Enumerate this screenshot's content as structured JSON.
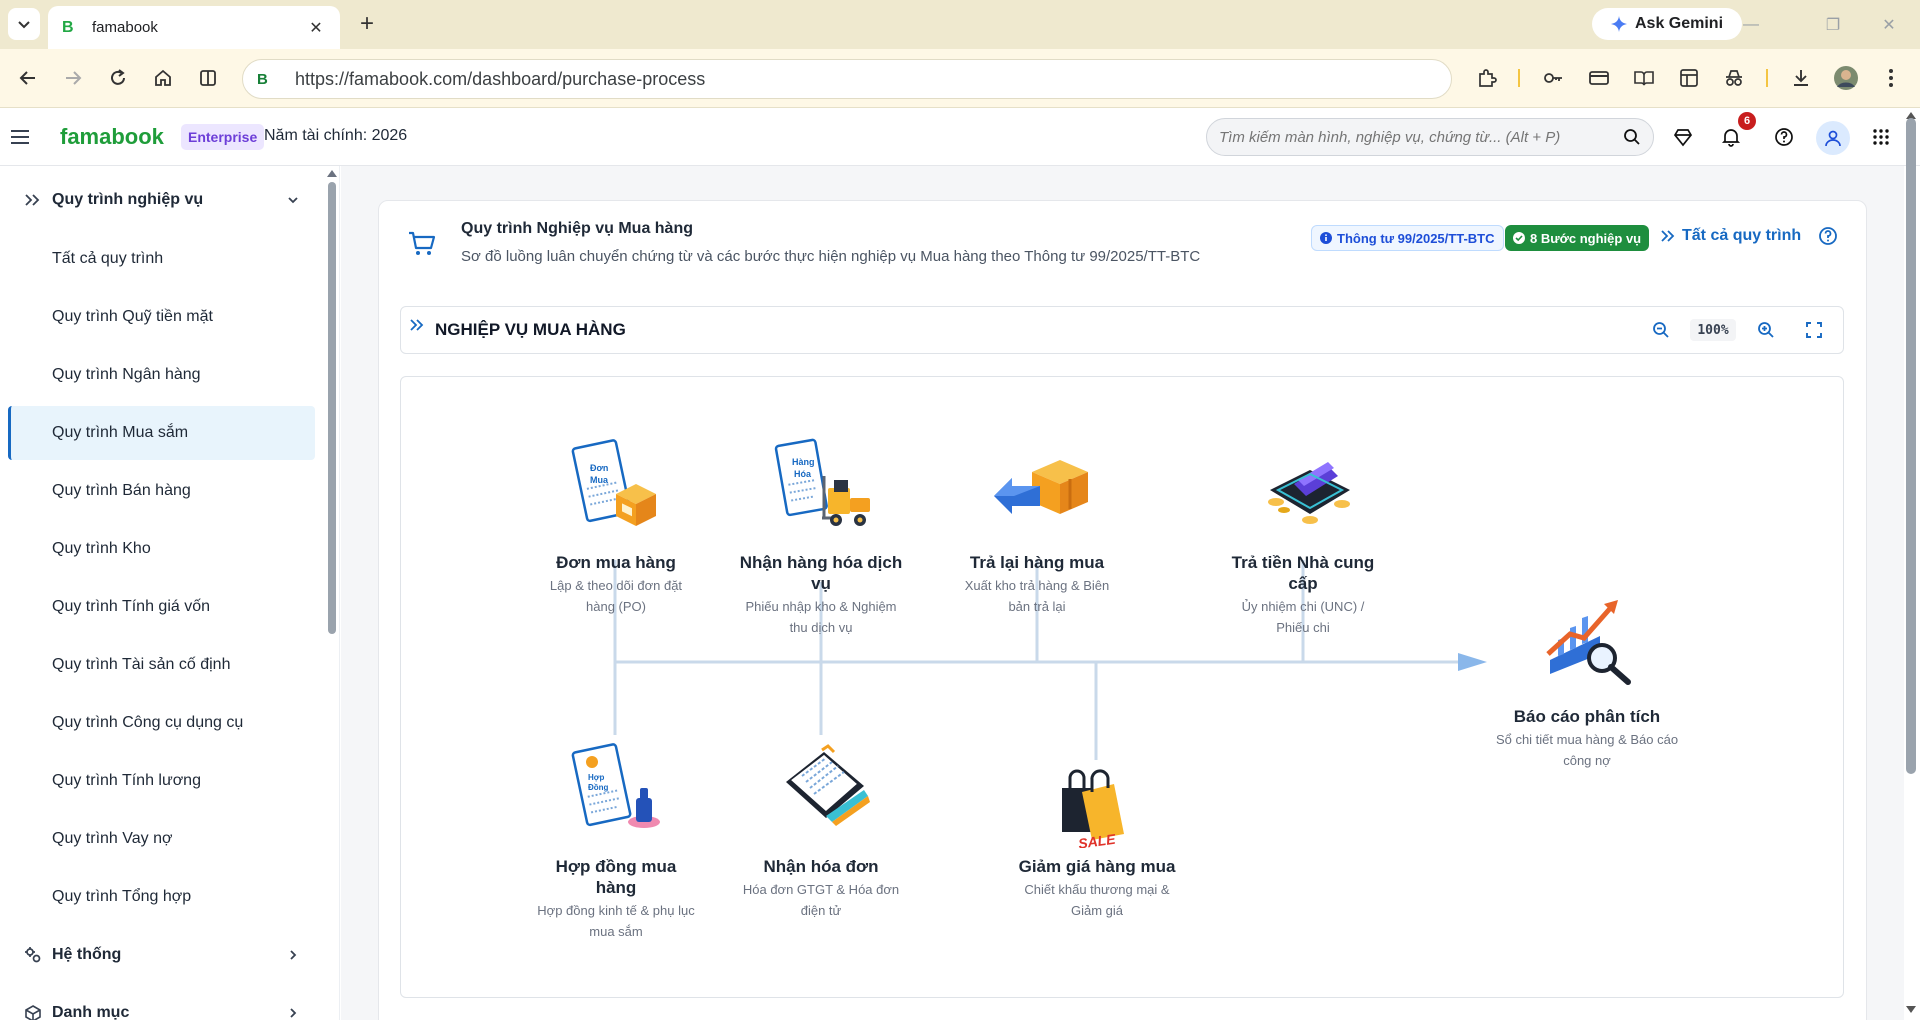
{
  "browser": {
    "tab_title": "famabook",
    "tab_favicon": "B",
    "url": "https://famabook.com/dashboard/purchase-process",
    "gemini_label": "Ask Gemini"
  },
  "header": {
    "logo": "famabook",
    "plan_badge": "Enterprise",
    "fiscal_year": "Năm tài chính: 2026",
    "search_placeholder": "Tìm kiếm màn hình, nghiệp vụ, chứng từ... (Alt + P)",
    "notification_count": "6"
  },
  "sidebar": {
    "section_process": "Quy trình nghiệp vụ",
    "items": [
      {
        "label": "Tất cả quy trình"
      },
      {
        "label": "Quy trình Quỹ tiền mặt"
      },
      {
        "label": "Quy trình Ngân hàng"
      },
      {
        "label": "Quy trình Mua sắm"
      },
      {
        "label": "Quy trình Bán hàng"
      },
      {
        "label": "Quy trình Kho"
      },
      {
        "label": "Quy trình Tính giá vốn"
      },
      {
        "label": "Quy trình Tài sản cố định"
      },
      {
        "label": "Quy trình Công cụ dụng cụ"
      },
      {
        "label": "Quy trình Tính lương"
      },
      {
        "label": "Quy trình Vay nợ"
      },
      {
        "label": "Quy trình Tổng hợp"
      }
    ],
    "section_system": "Hệ thống",
    "section_catalog": "Danh mục"
  },
  "process": {
    "title": "Quy trình Nghiệp vụ Mua hàng",
    "subtitle": "Sơ đồ luồng luân chuyển chứng từ và các bước thực hiện nghiệp vụ Mua hàng theo Thông tư 99/2025/TT-BTC",
    "circular_badge": "Thông tư 99/2025/TT-BTC",
    "steps_badge": "8 Bước nghiệp vụ",
    "all_processes_link": "Tất cả quy trình"
  },
  "diagram": {
    "title": "NGHIỆP VỤ MUA HÀNG",
    "zoom": "100%",
    "nodes": {
      "order": {
        "title": "Đơn mua hàng",
        "desc": "Lập & theo dõi đơn đặt hàng (PO)",
        "img_line1": "Đơn",
        "img_line2": "Mua"
      },
      "receive": {
        "title": "Nhận hàng hóa dịch vụ",
        "desc": "Phiếu nhập kho & Nghiệm thu dịch vụ",
        "img_line1": "Hàng",
        "img_line2": "Hóa"
      },
      "return": {
        "title": "Trả lại hàng mua",
        "desc": "Xuất kho trả hàng & Biên bản trả lại"
      },
      "pay": {
        "title": "Trả tiền Nhà cung cấp",
        "desc": "Ủy nhiệm chi (UNC) / Phiếu chi"
      },
      "report": {
        "title": "Báo cáo phân tích",
        "desc": "Sổ chi tiết mua hàng & Báo cáo công nợ"
      },
      "contract": {
        "title": "Hợp đồng mua hàng",
        "desc": "Hợp đồng kinh tế & phụ lục mua sắm",
        "img_line1": "Hợp",
        "img_line2": "Đồng"
      },
      "invoice": {
        "title": "Nhận hóa đơn",
        "desc": "Hóa đơn GTGT & Hóa đơn điện tử"
      },
      "discount": {
        "title": "Giảm giá hàng mua",
        "desc": "Chiết khấu thương mại & Giảm giá",
        "img_text": "SALE"
      }
    }
  },
  "colors": {
    "brand": "#1f9d3a",
    "link": "#1769c2",
    "flow_line": "#c9d9ea",
    "arrow": "#8ab7ea",
    "active_bg": "#e8f4fc"
  }
}
